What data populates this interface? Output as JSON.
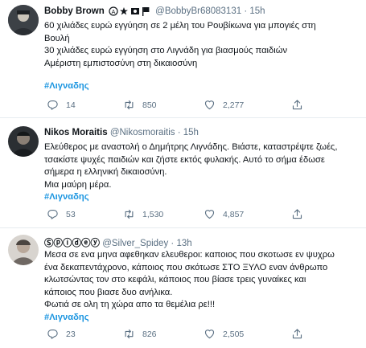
{
  "tweets": [
    {
      "display_name": "Bobby Brown",
      "handle": "@BobbyBr68083131",
      "time": "15h",
      "lines": [
        "60 χιλιάδες ευρώ εγγύηση σε 2 μέλη του Ρουβίκωνα για μπογιές στη",
        "Βουλή",
        "30 χιλιάδες ευρώ εγγύηση στο Λιγνάδη για βιασμούς παιδιών",
        "Αμέριστη εμπιστοσύνη στη δικαιοσύνη"
      ],
      "hashtag": "#Λιγναδης",
      "replies": "14",
      "retweets": "850",
      "likes": "2,277"
    },
    {
      "display_name": "Nikos Moraitis",
      "handle": "@Nikosmoraitis",
      "time": "15h",
      "lines": [
        "Ελεύθερος με αναστολή ο Δημήτρης Λιγνάδης. Βιάστε, καταστρέψτε ζωές,",
        "τσακίστε ψυχές παιδιών και ζήστε εκτός φυλακής. Αυτό το σήμα έδωσε",
        "σήμερα η ελληνική δικαιοσύνη.",
        "Μια μαύρη μέρα."
      ],
      "hashtag": "#Λιγναδης",
      "replies": "53",
      "retweets": "1,530",
      "likes": "4,857"
    },
    {
      "display_name": "Ⓢⓟⓘⓓⓔⓨ",
      "handle": "@Silver_Spidey",
      "time": "13h",
      "lines": [
        "Μεσα σε ενα μηνα αφεθηκαν ελευθεροι: καποιος που σκοτωσε εν ψυχρω",
        "ένα δεκαπεντάχρονο, κάποιος που σκότωσε ΣΤΟ ΞΥΛΟ εναν άνθρωπο",
        "κλωτσώντας τον στο κεφάλι, κάποιος που βίασε τρεις γυναίκες και",
        "κάποιος που βιασε δυο ανήλικα.",
        "Φωτιά σε ολη τη χώρα απο τα θεμέλια ρε!!!"
      ],
      "hashtag": "#Λιγναδης",
      "replies": "23",
      "retweets": "826",
      "likes": "2,505"
    }
  ],
  "icons": [
    "reply-icon",
    "retweet-icon",
    "like-icon",
    "share-icon"
  ],
  "colors": {
    "hashtag": "#1b95e0",
    "muted": "#5b7083",
    "divider": "#e6ecf0"
  }
}
